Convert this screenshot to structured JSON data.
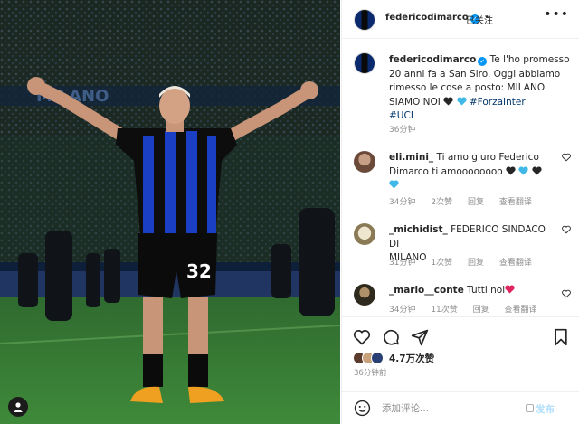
{
  "post": {
    "username": "federicodimarco",
    "follow_status": "已关注",
    "more_icon": "more-horizontal-icon",
    "caption_lines": [
      "Te l'ho promesso",
      "20 anni fa a San Siro. Oggi abbiamo",
      "rimesso le cose a posto: MILANO",
      "SIAMO NOI"
    ],
    "hashtags": [
      "#ForzaInter",
      "#UCL"
    ],
    "caption_time": "36分钟",
    "photo": {
      "banner_text": "MILANO",
      "jersey_number": "32"
    }
  },
  "comments": [
    {
      "username": "eli.mini_",
      "line1": "Ti amo giuro Federico",
      "line2": "Dimarco ti amoooooooo",
      "time": "34分钟",
      "likes": "2次赞",
      "reply": "回复",
      "translate": "查看翻译"
    },
    {
      "username": "_michidist_",
      "line1": "FEDERICO SINDACO DI",
      "line2": "MILANO",
      "time": "31分钟",
      "likes": "1次赞",
      "reply": "回复",
      "translate": "查看翻译"
    },
    {
      "username": "_mario__conte",
      "line1": "Tutti noi",
      "line2": "",
      "time": "34分钟",
      "likes": "11次赞",
      "reply": "回复",
      "translate": "查看翻译"
    }
  ],
  "actions": {
    "like_icon": "heart-icon",
    "comment_icon": "comment-icon",
    "share_icon": "send-icon",
    "save_icon": "bookmark-icon",
    "likes_count": "4.7万次赞",
    "post_time": "36分钟前"
  },
  "add_comment": {
    "placeholder": "添加评论...",
    "post_label": "发布"
  },
  "colors": {
    "accent_blue": "#0095f6",
    "inter_blue": "#0b2a6e",
    "hashtag": "#00376b",
    "muted": "#8e8e8e"
  }
}
